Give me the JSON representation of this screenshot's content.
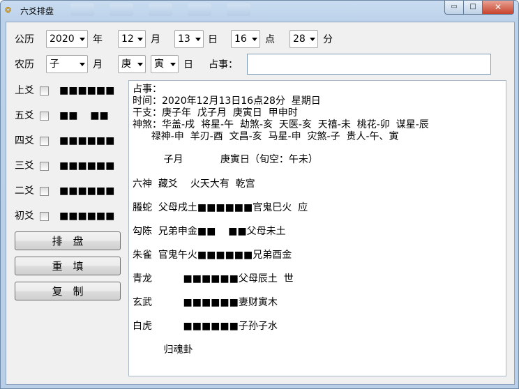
{
  "window": {
    "title": "六爻排盘",
    "icon": "coin-icon",
    "minimize": "▭",
    "maximize": "□",
    "close": "✕"
  },
  "solar": {
    "label": "公历",
    "year": "2020",
    "year_label": "年",
    "month": "12",
    "month_label": "月",
    "day": "13",
    "day_label": "日",
    "hour": "16",
    "hour_label": "点",
    "minute": "28",
    "minute_label": "分"
  },
  "lunar": {
    "label": "农历",
    "month": "子",
    "month_label": "月",
    "day_stem": "庚",
    "day_branch": "寅",
    "day_label": "日",
    "question_label": "占事：",
    "question_value": ""
  },
  "yao": [
    {
      "label": "上爻",
      "bars": "■■■■■■"
    },
    {
      "label": "五爻",
      "bars": "■■    ■■"
    },
    {
      "label": "四爻",
      "bars": "■■■■■■"
    },
    {
      "label": "三爻",
      "bars": "■■■■■■"
    },
    {
      "label": "二爻",
      "bars": "■■■■■■"
    },
    {
      "label": "初爻",
      "bars": "■■■■■■"
    }
  ],
  "buttons": {
    "arrange": "排　盘",
    "reset": "重　填",
    "copy": "复　制"
  },
  "result": [
    "占事：",
    "时间：2020年12月13日16点28分  星期日",
    "干支：庚子年  戊子月  庚寅日  甲申时",
    "神煞：华盖-戌  将星-午  劫煞-亥  天医-亥  天禧-未  桃花-卯  谋星-辰",
    "      禄神-申  羊刃-酉  文昌-亥  马星-申  灾煞-子  贵人-午、寅",
    "",
    "          子月            庚寅日（旬空：午未）",
    "",
    "六神  藏爻    火天大有  乾宫",
    "",
    "螣蛇  父母戌土■■■■■■官鬼巳火  应",
    "",
    "勾陈  兄弟申金■■    ■■父母未土",
    "",
    "朱雀  官鬼午火■■■■■■兄弟酉金",
    "",
    "青龙          ■■■■■■父母辰土  世",
    "",
    "玄武          ■■■■■■妻财寅木",
    "",
    "白虎          ■■■■■■子孙子水",
    "",
    "          归魂卦"
  ]
}
